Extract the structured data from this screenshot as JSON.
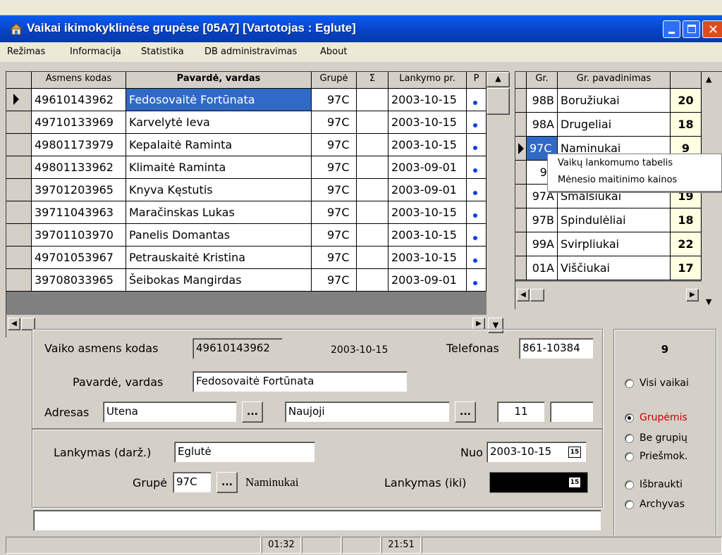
{
  "colors": {
    "title_bar": "#0a4fd8",
    "selection": "#316ac5",
    "desktop_bg": "#d4d0c8",
    "accent_red": "#cc0000",
    "close": "#e04a1e"
  },
  "window": {
    "title": "Vaikai ikimokyklinėse grupėse [05A7] [Vartotojas : Eglute]",
    "icon": "app-icon"
  },
  "menu": [
    "Režimas",
    "Informacija",
    "Statistika",
    "DB administravimas",
    "About"
  ],
  "children_grid": {
    "columns": [
      "Asmens kodas",
      "Pavardė, vardas",
      "Grupė",
      "Σ",
      "Lankymo pr.",
      "P"
    ],
    "rows": [
      {
        "code": "49610143962",
        "name": "Fedosovaitė Fortūnata",
        "group": "97C",
        "sum": "",
        "date": "2003-10-15",
        "selected": true
      },
      {
        "code": "49710133969",
        "name": "Karvelytė Ieva",
        "group": "97C",
        "sum": "",
        "date": "2003-10-15"
      },
      {
        "code": "49801173979",
        "name": "Kepalaitė Raminta",
        "group": "97C",
        "sum": "",
        "date": "2003-10-15"
      },
      {
        "code": "49801133962",
        "name": "Klimaitė Raminta",
        "group": "97C",
        "sum": "",
        "date": "2003-09-01"
      },
      {
        "code": "39701203965",
        "name": "Knyva Kęstutis",
        "group": "97C",
        "sum": "",
        "date": "2003-09-01"
      },
      {
        "code": "39711043963",
        "name": "Maračinskas Lukas",
        "group": "97C",
        "sum": "",
        "date": "2003-10-15"
      },
      {
        "code": "39701103970",
        "name": "Panelis Domantas",
        "group": "97C",
        "sum": "",
        "date": "2003-10-15"
      },
      {
        "code": "49701053967",
        "name": "Petrauskaitė Kristina",
        "group": "97C",
        "sum": "",
        "date": "2003-10-15"
      },
      {
        "code": "39708033965",
        "name": "Šeibokas Mangirdas",
        "group": "97C",
        "sum": "",
        "date": "2003-09-01"
      }
    ]
  },
  "groups_grid": {
    "columns": [
      "Gr.",
      "Gr. pavadinimas",
      ""
    ],
    "rows": [
      {
        "gr": "98B",
        "name": "Boružiukai",
        "count": "20"
      },
      {
        "gr": "98A",
        "name": "Drugeliai",
        "count": "18"
      },
      {
        "gr": "97C",
        "name": "Naminukai",
        "count": "9",
        "selected": true
      },
      {
        "gr": "99",
        "name": "",
        "count": ""
      },
      {
        "gr": "97A",
        "name": "Smalsiukai",
        "count": "19"
      },
      {
        "gr": "97B",
        "name": "Spindulėliai",
        "count": "18"
      },
      {
        "gr": "99A",
        "name": "Svirpliukai",
        "count": "22"
      },
      {
        "gr": "01A",
        "name": "Viščiukai",
        "count": "17"
      }
    ]
  },
  "context_menu": [
    "Vaikų lankomumo tabelis",
    "Mėnesio maitinimo kainos"
  ],
  "form": {
    "code_label": "Vaiko asmens kodas",
    "code_value": "49610143962",
    "date_value": "2003-10-15",
    "phone_label": "Telefonas",
    "phone_value": "861-10384",
    "name_label": "Pavardė, vardas",
    "name_value": "Fedosovaitė Fortūnata",
    "address_label": "Adresas",
    "city_value": "Utena",
    "street_value": "Naujoji",
    "house_value": "11",
    "flat_value": "",
    "ellipsis": "...",
    "kindergarten_label": "Lankymas (darž.)",
    "kindergarten_value": "Eglutė",
    "from_label": "Nuo",
    "from_value": "2003-10-15",
    "group_label": "Grupė",
    "group_value": "97C",
    "group_name": "Naminukai",
    "until_label": "Lankymas (iki)",
    "until_value": "",
    "calendar_glyph": "15",
    "notes_value": ""
  },
  "filter": {
    "count": "9",
    "options": [
      {
        "label": "Visi vaikai",
        "checked": false
      },
      {
        "label": "Grupėmis",
        "checked": true
      },
      {
        "label": "Be grupių",
        "checked": false
      },
      {
        "label": "Priešmok.",
        "checked": false
      },
      {
        "label": "Išbraukti",
        "checked": false
      },
      {
        "label": "Archyvas",
        "checked": false
      }
    ]
  },
  "status_bar": [
    "",
    "01:32",
    "",
    "",
    "21:51",
    ""
  ]
}
